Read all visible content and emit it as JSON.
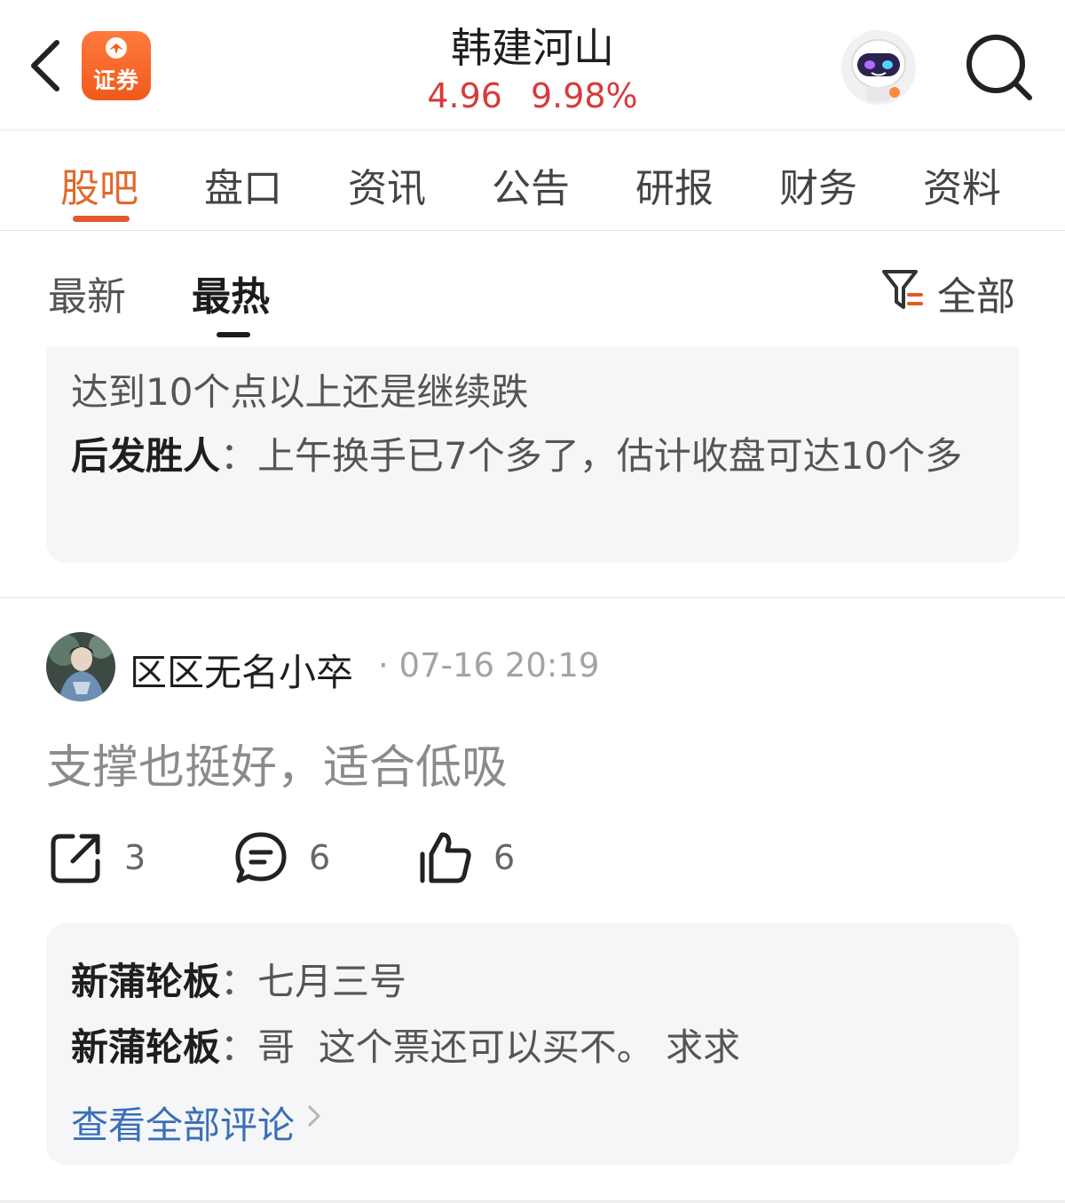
{
  "header": {
    "logo_text": "证券",
    "stock_name": "韩建河山",
    "price": "4.96",
    "change_pct": "9.98%",
    "price_color": "#d83a3a"
  },
  "main_tabs": [
    "股吧",
    "盘口",
    "资讯",
    "公告",
    "研报",
    "财务",
    "资料"
  ],
  "main_tab_active": "股吧",
  "sub_tabs": [
    "最新",
    "最热"
  ],
  "sub_tab_active": "最热",
  "filter_label": "全部",
  "card1": {
    "quote_text": "达到10个点以上还是继续跌",
    "reply_author": "后发胜人",
    "reply_sep": "：",
    "reply_text": "上午换手已7个多了，估计收盘可达10个多"
  },
  "post": {
    "username": "区区无名小卒",
    "time": "· 07-16 20:19",
    "text": "支撑也挺好，适合低吸",
    "share_count": "3",
    "comment_count": "6",
    "like_count": "6"
  },
  "comments": [
    {
      "author": "新蒲轮板",
      "sep": "：",
      "text": "七月三号"
    },
    {
      "author": "新蒲轮板",
      "sep": "：",
      "text": "哥  这个票还可以买不。 求求"
    }
  ],
  "view_all_label": "查看全部评论",
  "colors": {
    "accent": "#e2592a",
    "link": "#3b6fb6",
    "card_bg": "#f5f6f8"
  }
}
